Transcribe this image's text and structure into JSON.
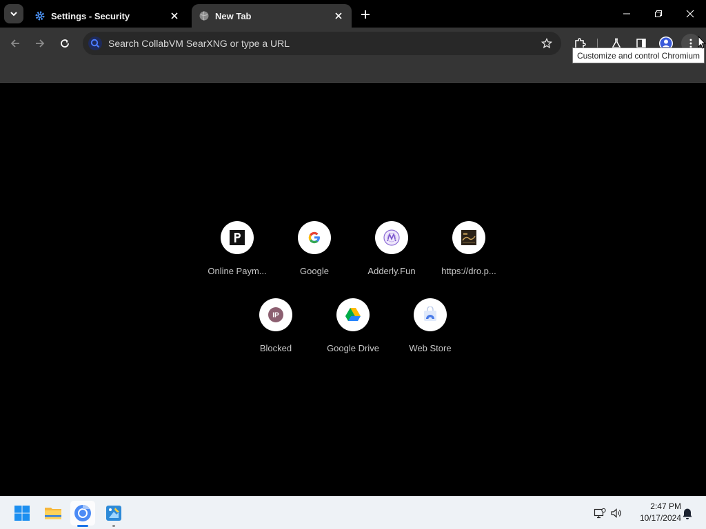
{
  "browser": {
    "tabs": [
      {
        "title": "Settings - Security",
        "favicon": "gear-icon",
        "active": false
      },
      {
        "title": "New Tab",
        "favicon": "globe-icon",
        "active": true
      }
    ],
    "omnibox": {
      "placeholder": "Search CollabVM SearXNG or type a URL",
      "value": ""
    },
    "tooltip": "Customize and control Chromium"
  },
  "ntp": {
    "shortcuts": [
      {
        "label": "Online Paym...",
        "icon": "paypal-icon"
      },
      {
        "label": "Google",
        "icon": "google-icon"
      },
      {
        "label": "Adderly.Fun",
        "icon": "adderly-icon"
      },
      {
        "label": "https://dro.p...",
        "icon": "site-thumbnail-icon"
      },
      {
        "label": "Blocked",
        "icon": "ip-icon"
      },
      {
        "label": "Google Drive",
        "icon": "google-drive-icon"
      },
      {
        "label": "Web Store",
        "icon": "web-store-icon"
      }
    ],
    "ip_badge": "IP"
  },
  "taskbar": {
    "apps": [
      "start-icon",
      "file-explorer-icon",
      "chromium-icon",
      "paint-icon"
    ],
    "clock": {
      "time": "2:47 PM",
      "date": "10/17/2024"
    }
  },
  "colors": {
    "accent": "#1a73e8",
    "tab_active": "#353535",
    "page_bg": "#000000",
    "taskbar_bg": "#eef2f6"
  }
}
